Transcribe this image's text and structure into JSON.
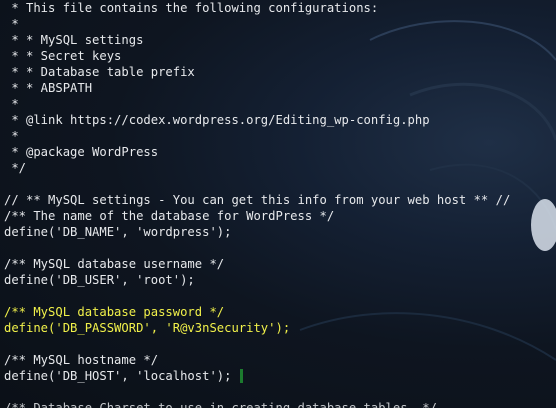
{
  "editor": {
    "lines": [
      {
        "text": " * This file contains the following configurations:",
        "highlight": false
      },
      {
        "text": " *",
        "highlight": false
      },
      {
        "text": " * * MySQL settings",
        "highlight": false
      },
      {
        "text": " * * Secret keys",
        "highlight": false
      },
      {
        "text": " * * Database table prefix",
        "highlight": false
      },
      {
        "text": " * * ABSPATH",
        "highlight": false
      },
      {
        "text": " *",
        "highlight": false
      },
      {
        "text": " * @link https://codex.wordpress.org/Editing_wp-config.php",
        "highlight": false
      },
      {
        "text": " *",
        "highlight": false
      },
      {
        "text": " * @package WordPress",
        "highlight": false
      },
      {
        "text": " */",
        "highlight": false
      },
      {
        "text": "",
        "highlight": false
      },
      {
        "text": "// ** MySQL settings - You can get this info from your web host ** //",
        "highlight": false
      },
      {
        "text": "/** The name of the database for WordPress */",
        "highlight": false
      },
      {
        "text": "define('DB_NAME', 'wordpress');",
        "highlight": false
      },
      {
        "text": "",
        "highlight": false
      },
      {
        "text": "/** MySQL database username */",
        "highlight": false
      },
      {
        "text": "define('DB_USER', 'root');",
        "highlight": false
      },
      {
        "text": "",
        "highlight": false
      },
      {
        "text": "/** MySQL database password */",
        "highlight": true
      },
      {
        "text": "define('DB_PASSWORD', 'R@v3nSecurity');",
        "highlight": true
      },
      {
        "text": "",
        "highlight": false
      },
      {
        "text": "/** MySQL hostname */",
        "highlight": false
      },
      {
        "text": "define('DB_HOST', 'localhost');",
        "highlight": false,
        "cursor": true
      },
      {
        "text": "",
        "highlight": false
      },
      {
        "text": "/** Database Charset to use in creating database tables. */",
        "highlight": false,
        "cut": true
      }
    ]
  },
  "colors": {
    "text": "#e7e9ec",
    "highlight": "#f1f14a",
    "cursor": "#1c7a2e",
    "background": "#0e1219"
  }
}
